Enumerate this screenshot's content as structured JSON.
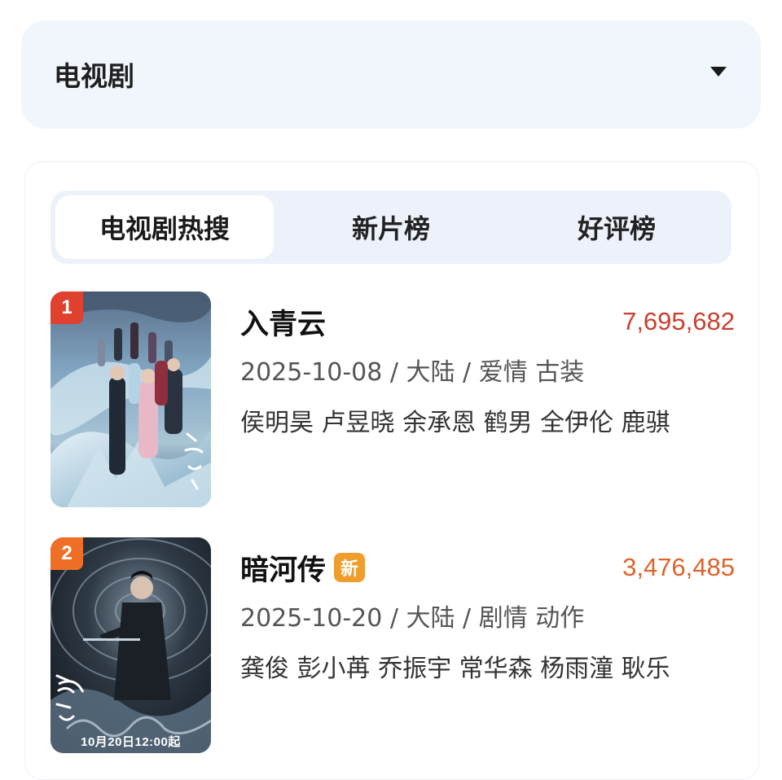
{
  "category": {
    "label": "电视剧"
  },
  "tabs": [
    {
      "label": "电视剧热搜",
      "active": true
    },
    {
      "label": "新片榜",
      "active": false
    },
    {
      "label": "好评榜",
      "active": false
    }
  ],
  "items": [
    {
      "rank": "1",
      "rank_color": "#e0402e",
      "title": "入青云",
      "is_new": false,
      "heat": "7,695,682",
      "heat_color": "#c9402e",
      "meta": "2025-10-08 / 大陆 / 爱情 古装",
      "cast": "侯明昊 卢昱晓 余承恩 鹤男 全伊伦 鹿骐",
      "poster_text": ""
    },
    {
      "rank": "2",
      "rank_color": "#ef6f26",
      "title": "暗河传",
      "is_new": true,
      "new_badge": "新",
      "heat": "3,476,485",
      "heat_color": "#e0632a",
      "meta": "2025-10-20 / 大陆 / 剧情 动作",
      "cast": "龚俊 彭小苒 乔振宇 常华森 杨雨潼 耿乐",
      "poster_text": "10月20日12:00起"
    }
  ]
}
